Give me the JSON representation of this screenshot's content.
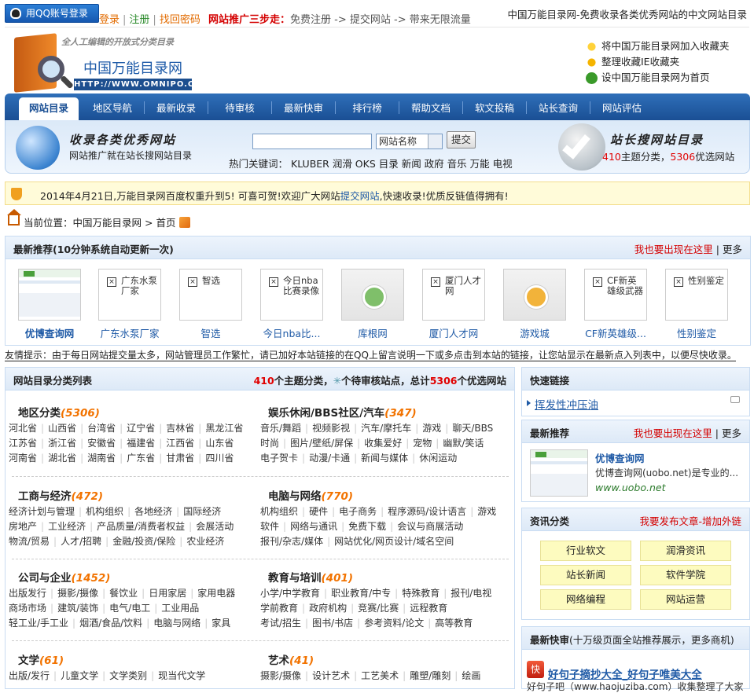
{
  "topbar": {
    "qq_login": "用QQ账号登录",
    "login": "登录",
    "register": "注册",
    "retrieve": "找回密码",
    "steps_label": "网站推广三步走：",
    "step1": "免费注册",
    "arrow": "->",
    "step2": "提交网站",
    "step3": "带来无限流量",
    "site_title": "中国万能目录网-免费收录各类优秀网站的中文网站目录"
  },
  "logo": {
    "slogan": "全人工编辑的开放式分类目录",
    "name": "中国万能目录网",
    "url": "HTTP://WWW.OMNIPO.CN"
  },
  "favorites": [
    "将中国万能目录网加入收藏夹",
    "整理收藏IE收藏夹",
    "设中国万能目录网为首页"
  ],
  "nav": [
    "网站目录",
    "地区导航",
    "最新收录",
    "待审核",
    "最新快审",
    "排行榜",
    "帮助文档",
    "软文投稿",
    "站长查询",
    "网站评估"
  ],
  "band": {
    "title": "收录各类优秀网站",
    "subtitle": "网站推广就在站长搜网站目录",
    "search_select": "网站名称",
    "search_button": "提交",
    "hot_label": "热门关键词：",
    "hot_keywords": "KLUBER 润滑 OKS 目录 新闻 政府 音乐 万能 电视",
    "title2": "站长搜网站目录",
    "stat_topics": "410",
    "stat_topics_label": "主题分类，",
    "stat_sites": "5306",
    "stat_sites_label": "优选网站"
  },
  "notice": {
    "text1": "2014年4月21日,万能目录网百度权重升到5! 可喜可贺!欢迎广大网站",
    "link": "提交网站",
    "text2": ",快速收录!优质反链值得拥有!"
  },
  "breadcrumb": {
    "label": "当前位置：",
    "site": "中国万能目录网",
    "sep": ">",
    "page": "首页"
  },
  "recommend": {
    "title": "最新推荐(10分钟系统自动更新一次)",
    "ad": "我也要出现在这里",
    "sep": "|",
    "more": "更多",
    "items": [
      {
        "caption": "优博查询网",
        "alt": ""
      },
      {
        "caption": "广东水泵厂家",
        "alt": "广东水泵厂家"
      },
      {
        "caption": "智选",
        "alt": "智选"
      },
      {
        "caption": "今日nba比...",
        "alt": "今日nba比赛录像"
      },
      {
        "caption": "库根网",
        "alt": ""
      },
      {
        "caption": "厦门人才网",
        "alt": "厦门人才网"
      },
      {
        "caption": "游戏城",
        "alt": ""
      },
      {
        "caption": "CF新英雄级...",
        "alt": "CF新英雄级武器"
      },
      {
        "caption": "性别鉴定",
        "alt": "性别鉴定"
      }
    ]
  },
  "tip": "友情提示：由于每日网站提交量太多，网站管理员工作繁忙，请已加好本站链接的在QQ上留言说明一下或多点击到本站的链接，让您站显示在最新点入列表中，以便尽快收录。",
  "directory": {
    "title": "网站目录分类列表",
    "stat_topics": "410",
    "stat_topics_label": "个主题分类，",
    "stat_pending_label": "个待审核站点，总计",
    "stat_sites": "5306",
    "stat_sites_label": "个优选网站",
    "categories": [
      {
        "name": "地区分类",
        "count": "(5306)",
        "lines": [
          [
            "河北省",
            "山西省",
            "台湾省",
            "辽宁省",
            "吉林省",
            "黑龙江省"
          ],
          [
            "江苏省",
            "浙江省",
            "安徽省",
            "福建省",
            "江西省",
            "山东省"
          ],
          [
            "河南省",
            "湖北省",
            "湖南省",
            "广东省",
            "甘肃省",
            "四川省"
          ]
        ]
      },
      {
        "name": "娱乐休闲/BBS社区/汽车",
        "count": "(347)",
        "lines": [
          [
            "音乐/舞蹈",
            "视频影视",
            "汽车/摩托车",
            "游戏",
            "聊天/BBS"
          ],
          [
            "时尚",
            "图片/壁纸/屏保",
            "收集爱好",
            "宠物",
            "幽默/笑话"
          ],
          [
            "电子贺卡",
            "动漫/卡通",
            "新闻与媒体",
            "休闲运动"
          ]
        ]
      },
      {
        "name": "工商与经济",
        "count": "(472)",
        "lines": [
          [
            "经济计划与管理",
            "机构组织",
            "各地经济",
            "国际经济"
          ],
          [
            "房地产",
            "工业经济",
            "产品质量/消费者权益",
            "会展活动"
          ],
          [
            "物流/贸易",
            "人才/招聘",
            "金融/投资/保险",
            "农业经济"
          ]
        ]
      },
      {
        "name": "电脑与网络",
        "count": "(770)",
        "lines": [
          [
            "机构组织",
            "硬件",
            "电子商务",
            "程序源码/设计语言",
            "游戏"
          ],
          [
            "软件",
            "网络与通讯",
            "免费下载",
            "会议与商展活动"
          ],
          [
            "报刊/杂志/媒体",
            "网站优化/网页设计/域名空间"
          ]
        ]
      },
      {
        "name": "公司与企业",
        "count": "(1452)",
        "lines": [
          [
            "出版发行",
            "摄影/摄像",
            "餐饮业",
            "日用家居",
            "家用电器"
          ],
          [
            "商场市场",
            "建筑/装饰",
            "电气/电工",
            "工业用品"
          ],
          [
            "轻工业/手工业",
            "烟酒/食品/饮料",
            "电脑与网络",
            "家具"
          ]
        ]
      },
      {
        "name": "教育与培训",
        "count": "(401)",
        "lines": [
          [
            "小学/中学教育",
            "职业教育/中专",
            "特殊教育",
            "报刊/电视"
          ],
          [
            "学前教育",
            "政府机构",
            "竞赛/比赛",
            "远程教育"
          ],
          [
            "考试/招生",
            "图书/书店",
            "参考资料/论文",
            "高等教育"
          ]
        ]
      },
      {
        "name": "文学",
        "count": "(61)",
        "lines": [
          [
            "出版/发行",
            "儿童文学",
            "文学类别",
            "现当代文学"
          ]
        ]
      },
      {
        "name": "艺术",
        "count": "(41)",
        "lines": [
          [
            "摄影/摄像",
            "设计艺术",
            "工艺美术",
            "雕塑/雕刻",
            "绘画"
          ]
        ]
      }
    ]
  },
  "quick": {
    "title": "快速链接",
    "link": "挥发性冲压油"
  },
  "rec2": {
    "title": "最新推荐",
    "ad": "我也要出现在这里",
    "sep": "|",
    "more": "更多",
    "name": "优博查询网",
    "desc": "优博查询网(uobo.net)是专业的...",
    "url": "www.uobo.net"
  },
  "zixun": {
    "title": "资讯分类",
    "ad": "我要发布文章-增加外链",
    "items": [
      "行业软文",
      "润滑资讯",
      "站长新闻",
      "软件学院",
      "网络编程",
      "网站运营"
    ]
  },
  "kuaixun": {
    "title": "最新快审",
    "sub": "(十万级页面全站推荐展示，更多商机)",
    "icon": "快",
    "link": "好句子摘抄大全_好句子唯美大全",
    "desc": "好句子吧（www.haojuziba.com）收集整理了大家"
  }
}
